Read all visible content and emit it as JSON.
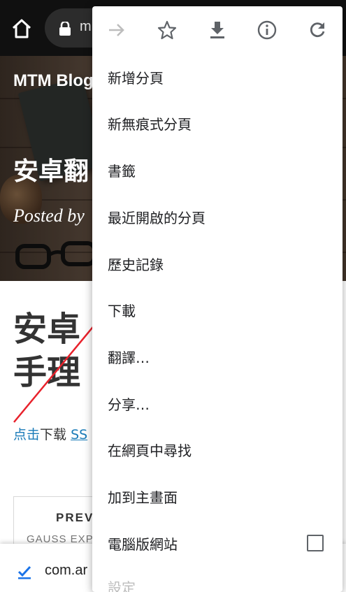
{
  "browser": {
    "url_text": "m"
  },
  "hero": {
    "blog_title": "MTM Blog",
    "heading": "安卓翻",
    "meta": "Posted by"
  },
  "article": {
    "title": "安卓手理",
    "line_blue": "点击",
    "line_text": "下载 ",
    "line_link": "SS"
  },
  "prev_card": {
    "label": "PREV",
    "subtitle": "GAUSS EXP"
  },
  "download_bar": {
    "text": "com.ar"
  },
  "menu": {
    "icons": [
      "forward-icon",
      "star-icon",
      "download-icon",
      "info-icon",
      "refresh-icon"
    ],
    "items": [
      {
        "label": "新增分頁"
      },
      {
        "label": "新無痕式分頁"
      },
      {
        "label": "書籤"
      },
      {
        "label": "最近開啟的分頁"
      },
      {
        "label": "歷史記錄"
      },
      {
        "label": "下載"
      },
      {
        "label": "翻譯…"
      },
      {
        "label": "分享…"
      },
      {
        "label": "在網頁中尋找"
      },
      {
        "label": "加到主畫面"
      },
      {
        "label": "電腦版網站"
      },
      {
        "label": "設定"
      }
    ]
  },
  "colors": {
    "accent": "#1a73e8",
    "annotation": "#e8212b",
    "link": "#1a7bb8"
  }
}
